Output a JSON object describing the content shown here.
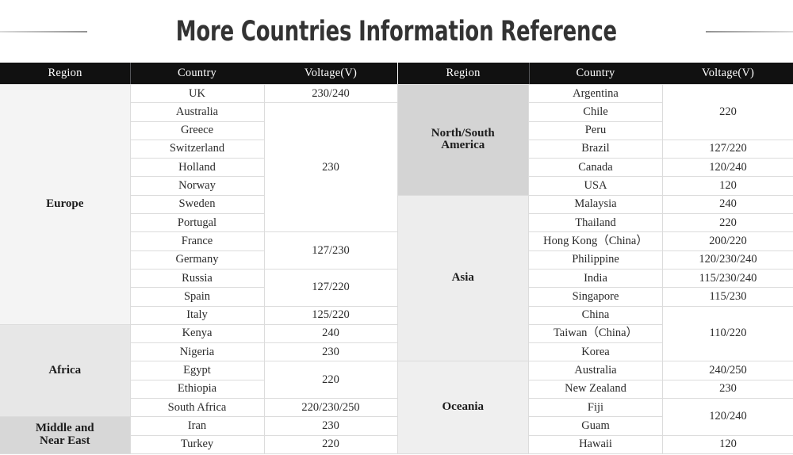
{
  "title": "More Countries Information Reference",
  "headers": {
    "region": "Region",
    "country": "Country",
    "voltage": "Voltage(V)"
  },
  "colors": {
    "header_bg": "#111111",
    "header_text": "#ffffff",
    "title_text": "#333333",
    "grid_line": "#dcdcdc",
    "region_tint_europe": "#f4f4f4",
    "region_tint_africa": "#e7e7e7",
    "region_tint_middle_east": "#d7d7d7",
    "region_tint_americas": "#d4d4d4",
    "region_tint_asia": "#ededed",
    "region_tint_oceania": "#efefef"
  },
  "left_table": {
    "regions": [
      {
        "name": "Europe",
        "tint": "tint-1",
        "rows": [
          {
            "country": "UK",
            "voltage": "230/240",
            "voltage_span": 1
          },
          {
            "country": "Australia",
            "voltage": "230",
            "voltage_span": 7
          },
          {
            "country": "Greece",
            "voltage": null
          },
          {
            "country": "Switzerland",
            "voltage": null
          },
          {
            "country": "Holland",
            "voltage": null
          },
          {
            "country": "Norway",
            "voltage": null
          },
          {
            "country": "Sweden",
            "voltage": null
          },
          {
            "country": "Portugal",
            "voltage": null
          },
          {
            "country": "France",
            "voltage": "127/230",
            "voltage_span": 2
          },
          {
            "country": "Germany",
            "voltage": null
          },
          {
            "country": "Russia",
            "voltage": "127/220",
            "voltage_span": 2
          },
          {
            "country": "Spain",
            "voltage": null
          },
          {
            "country": "Italy",
            "voltage": "125/220",
            "voltage_span": 1
          }
        ]
      },
      {
        "name": "Africa",
        "tint": "tint-2",
        "rows": [
          {
            "country": "Kenya",
            "voltage": "240",
            "voltage_span": 1
          },
          {
            "country": "Nigeria",
            "voltage": "230",
            "voltage_span": 1
          },
          {
            "country": "Egypt",
            "voltage": "220",
            "voltage_span": 2
          },
          {
            "country": "Ethiopia",
            "voltage": null
          },
          {
            "country": "South Africa",
            "voltage": "220/230/250",
            "voltage_span": 1
          }
        ]
      },
      {
        "name": "Middle and\nNear East",
        "tint": "tint-3",
        "rows": [
          {
            "country": "Iran",
            "voltage": "230",
            "voltage_span": 1
          },
          {
            "country": "Turkey",
            "voltage": "220",
            "voltage_span": 1
          }
        ]
      }
    ]
  },
  "right_table": {
    "regions": [
      {
        "name": "North/South\nAmerica",
        "tint": "tint-4",
        "rows": [
          {
            "country": "Argentina",
            "voltage": "220",
            "voltage_span": 3
          },
          {
            "country": "Chile",
            "voltage": null
          },
          {
            "country": "Peru",
            "voltage": null
          },
          {
            "country": "Brazil",
            "voltage": "127/220",
            "voltage_span": 1
          },
          {
            "country": "Canada",
            "voltage": "120/240",
            "voltage_span": 1
          },
          {
            "country": "USA",
            "voltage": "120",
            "voltage_span": 1
          }
        ]
      },
      {
        "name": "Asia",
        "tint": "tint-5",
        "rows": [
          {
            "country": "Malaysia",
            "voltage": "240",
            "voltage_span": 1
          },
          {
            "country": "Thailand",
            "voltage": "220",
            "voltage_span": 1
          },
          {
            "country": "Hong Kong（China）",
            "voltage": "200/220",
            "voltage_span": 1
          },
          {
            "country": "Philippine",
            "voltage": "120/230/240",
            "voltage_span": 1
          },
          {
            "country": "India",
            "voltage": "115/230/240",
            "voltage_span": 1
          },
          {
            "country": "Singapore",
            "voltage": "115/230",
            "voltage_span": 1
          },
          {
            "country": "China",
            "voltage": "110/220",
            "voltage_span": 3
          },
          {
            "country": "Taiwan（China）",
            "voltage": null
          },
          {
            "country": "Korea",
            "voltage": null
          }
        ]
      },
      {
        "name": "Oceania",
        "tint": "tint-6",
        "rows": [
          {
            "country": "Australia",
            "voltage": "240/250",
            "voltage_span": 1
          },
          {
            "country": "New Zealand",
            "voltage": "230",
            "voltage_span": 1
          },
          {
            "country": "Fiji",
            "voltage": "120/240",
            "voltage_span": 2
          },
          {
            "country": "Guam",
            "voltage": null
          },
          {
            "country": "Hawaii",
            "voltage": "120",
            "voltage_span": 1
          }
        ]
      }
    ]
  }
}
